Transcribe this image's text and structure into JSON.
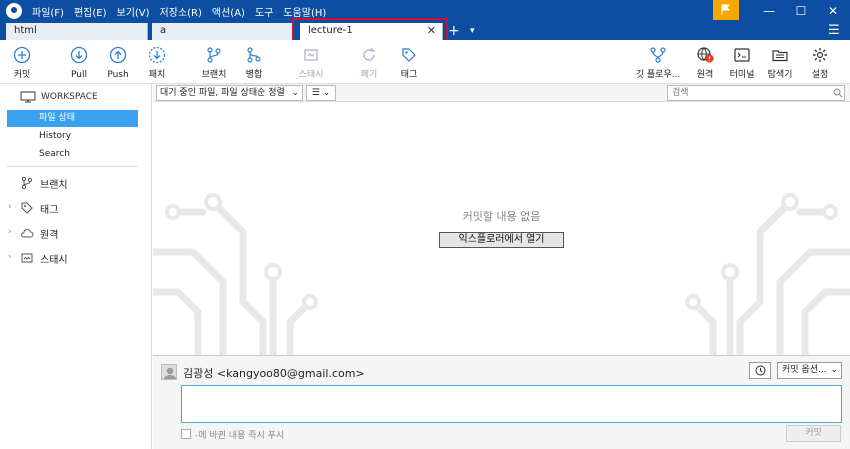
{
  "menu": [
    "파일(F)",
    "편집(E)",
    "보기(V)",
    "저장소(R)",
    "액션(A)",
    "도구",
    "도움말(H)"
  ],
  "window_controls": {
    "minimize": "—",
    "maximize": "☐",
    "close": "✕"
  },
  "tabs": [
    {
      "label": "html"
    },
    {
      "label": "a"
    },
    {
      "label": "lecture-1",
      "close": "✕"
    }
  ],
  "tab_add": "+",
  "tab_dropdown": "▾",
  "tabs_menu": "☰",
  "toolbar": {
    "commit": "커밋",
    "pull": "Pull",
    "push": "Push",
    "fetch": "패치",
    "branch": "브랜치",
    "merge": "병합",
    "stash": "스태시",
    "discard": "폐기",
    "tag": "태그",
    "git_flow": "깃 플로우...",
    "remote": "원격",
    "terminal": "터미널",
    "explorer": "탐색기",
    "settings": "설정"
  },
  "sidebar": {
    "workspace": "WORKSPACE",
    "items": [
      {
        "label": "파일 상태"
      },
      {
        "label": "History"
      },
      {
        "label": "Search"
      }
    ],
    "groups": [
      {
        "label": "브랜치",
        "chevron": ""
      },
      {
        "label": "태그",
        "chevron": "›"
      },
      {
        "label": "원격",
        "chevron": "›"
      },
      {
        "label": "스태시",
        "chevron": "›"
      }
    ]
  },
  "filter": {
    "selected": "대기 중인 파일, 파일 상태순 정렬",
    "view": "☰",
    "search_placeholder": "검색"
  },
  "empty_state": {
    "title": "커밋할 내용 없음",
    "open_explorer": "익스플로러에서 열기"
  },
  "commit": {
    "author": "김광성 <kangyoo80@gmail.com>",
    "options": "커밋 옵션...",
    "message_value": "",
    "push_label": "-에 바뀐 내용 즉시 푸시",
    "button": "커밋"
  },
  "colors": {
    "titlebar": "#0b4ea2",
    "accent": "#3aa0f0",
    "highlight": "#d0112b",
    "flag": "#f6a800"
  }
}
